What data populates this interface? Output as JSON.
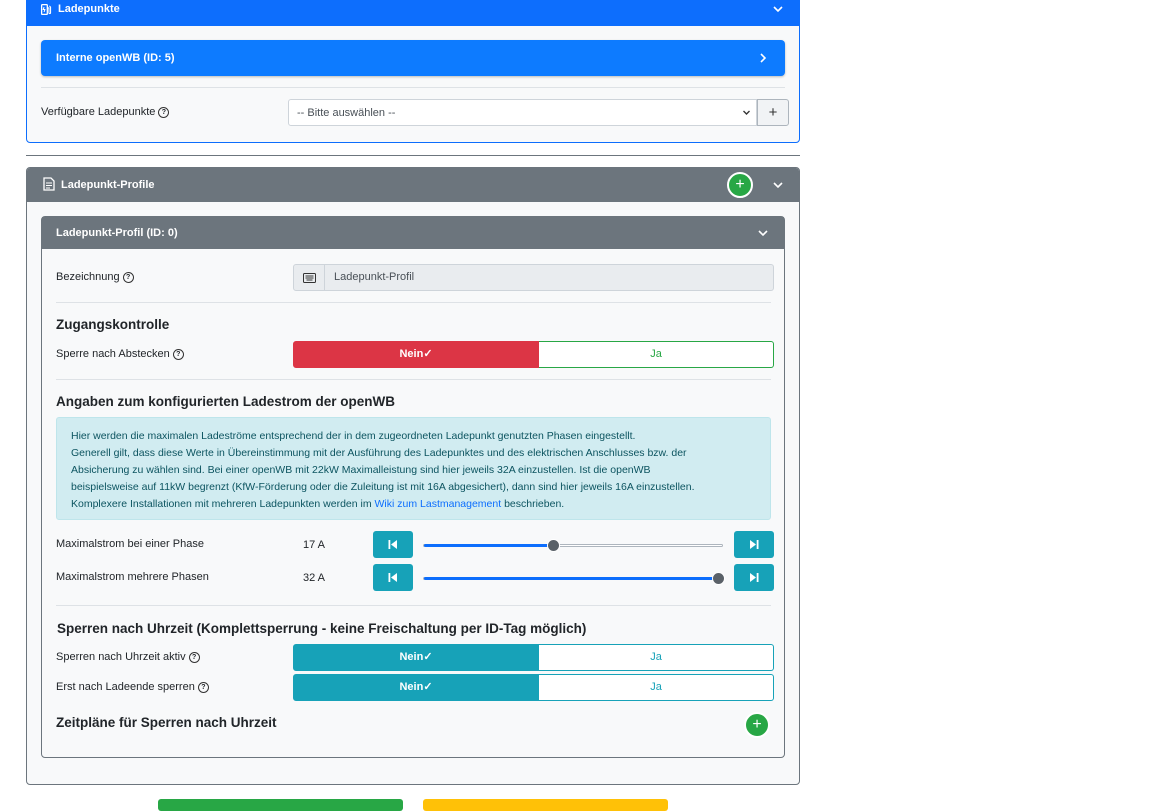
{
  "ladepunkte": {
    "header_title": "Ladepunkte",
    "item_label": "Interne openWB (ID: 5)",
    "available_label": "Verfügbare Ladepunkte",
    "select_value": "-- Bitte auswählen --",
    "add_symbol": "+"
  },
  "profiles": {
    "header_title": "Ladepunkt-Profile",
    "add_symbol": "+",
    "profile": {
      "header_title": "Ladepunkt-Profil (ID: 0)",
      "bezeichnung_label": "Bezeichnung",
      "bezeichnung_value": "Ladepunkt-Profil",
      "zugang_title": "Zugangskontrolle",
      "sperre_label": "Sperre nach Abstecken",
      "no_label": "Nein",
      "yes_label": "Ja",
      "check": "✓",
      "ladestrom_title": "Angaben zum konfigurierten Ladestrom der openWB",
      "info_line1": "Hier werden die maximalen Ladeströme entsprechend der in dem zugeordneten Ladepunkt genutzten Phasen eingestellt.",
      "info_line2": "Generell gilt, dass diese Werte in Übereinstimmung mit der Ausführung des Ladepunktes und des elektrischen Anschlusses bzw. der",
      "info_line3": "Absicherung zu wählen sind. Bei einer openWB mit 22kW Maximalleistung sind hier jeweils 32A einzustellen. Ist die openWB",
      "info_line4": "beispielsweise auf 11kW begrenzt (KfW-Förderung oder die Zuleitung ist mit 16A abgesichert), dann sind hier jeweils 16A einzustellen.",
      "info_line5_prefix": "Komplexere Installationen mit mehreren Ladepunkten werden im ",
      "info_link": "Wiki zum Lastmanagement",
      "info_line5_suffix": " beschrieben.",
      "max_one_label": "Maximalstrom bei einer Phase",
      "max_one_value": "17 A",
      "max_one_fraction": 0.43,
      "max_multi_label": "Maximalstrom mehrere Phasen",
      "max_multi_value": "32 A",
      "max_multi_fraction": 0.98,
      "uhrzeit_title": "Sperren nach Uhrzeit (Komplettsperrung - keine Freischaltung per ID-Tag möglich)",
      "uhrzeit_aktiv_label": "Sperren nach Uhrzeit aktiv",
      "ladeende_label": "Erst nach Ladeende sperren",
      "zeitplaene_title": "Zeitpläne für Sperren nach Uhrzeit",
      "add_symbol": "+"
    }
  },
  "colors": {
    "primary": "#0d6efd",
    "secondary": "#6c757d",
    "danger": "#dc3545",
    "success": "#28a745",
    "info": "#17a2b8",
    "warning": "#ffc107"
  }
}
